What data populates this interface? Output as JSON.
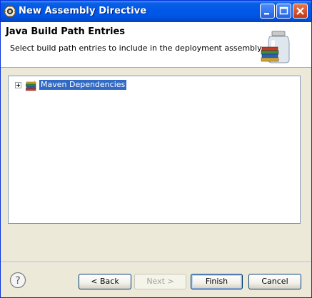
{
  "window": {
    "title": "New Assembly Directive",
    "controls": {
      "minimize": "minimize-icon",
      "maximize": "maximize-icon",
      "close": "close-icon"
    }
  },
  "header": {
    "title": "Java Build Path Entries",
    "description": "Select build path entries to include in the deployment assembly.",
    "banner_icon": "library-jar-icon"
  },
  "tree": {
    "items": [
      {
        "label": "Maven Dependencies",
        "icon": "library-books-icon",
        "expander": "plus",
        "selected": true
      }
    ]
  },
  "buttons": {
    "help_icon": "help-icon",
    "back": "< Back",
    "next": "Next >",
    "finish": "Finish",
    "cancel": "Cancel"
  },
  "colors": {
    "titlebar": "#0055e5",
    "selection": "#316ac5",
    "dialog_bg": "#ece9d8"
  }
}
